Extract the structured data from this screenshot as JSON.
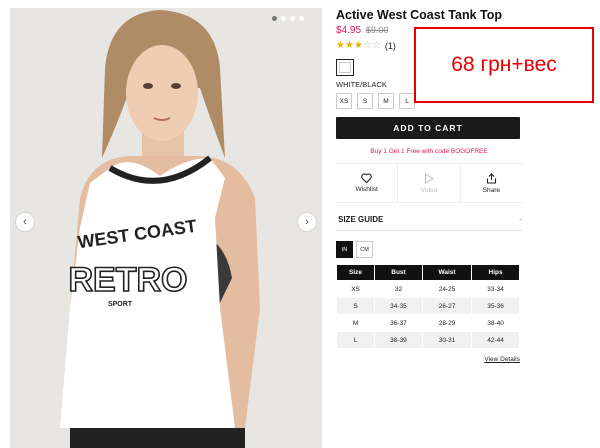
{
  "product": {
    "title": "Active West Coast Tank Top",
    "price": "$4.95",
    "old_price": "$9.00",
    "rating": 3,
    "rating_max": 5,
    "review_count": "(1)",
    "color_label": "WHITE/BLACK",
    "sizes": [
      "XS",
      "S",
      "M",
      "L"
    ],
    "add_to_cart": "ADD TO CART",
    "promo": "Buy 1 Get 1 Free with code BOGOFREE"
  },
  "gallery": {
    "print_line1": "WEST COAST",
    "print_line2": "RETRO",
    "print_line3": "SPORT",
    "slide": 1,
    "slide_count": 4
  },
  "actions": {
    "wishlist": "Wishlist",
    "video": "Video",
    "share": "Share"
  },
  "size_guide": {
    "title": "SIZE GUIDE",
    "toggle_symbol": "-",
    "units": [
      "IN",
      "CM"
    ],
    "active_unit": "IN",
    "headers": [
      "Size",
      "Bust",
      "Waist",
      "Hips"
    ],
    "rows": [
      [
        "XS",
        "32",
        "24-25",
        "33-34"
      ],
      [
        "S",
        "34-35",
        "26-27",
        "35-36"
      ],
      [
        "M",
        "36-37",
        "28-29",
        "38-40"
      ],
      [
        "L",
        "38-39",
        "30-31",
        "42-44"
      ]
    ],
    "view_details": "View Details"
  },
  "annotation": {
    "text": "68 грн+вес"
  },
  "colors": {
    "price_pink": "#d8195d",
    "star_gold": "#e8b100",
    "annotation_red": "#e60000",
    "button_black": "#1a1a1a"
  }
}
